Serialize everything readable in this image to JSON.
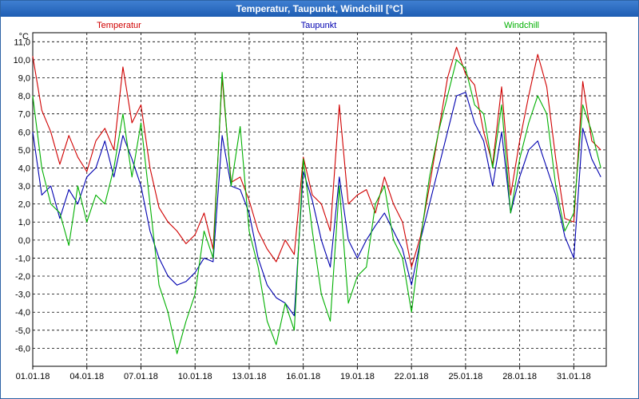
{
  "window": {
    "title": "Temperatur, Taupunkt, Windchill [°C]"
  },
  "colors": {
    "temperatur": "#d00000",
    "taupunkt": "#0000b0",
    "windchill": "#00b000",
    "grid": "#000000",
    "titlebar": "#2a6cc4"
  },
  "chart_data": {
    "type": "line",
    "title": "Temperatur, Taupunkt, Windchill [°C]",
    "unit": "°C",
    "ylim": [
      -7,
      11.5
    ],
    "xlim": [
      0,
      31.8
    ],
    "yticks": [
      11,
      10,
      9,
      8,
      7,
      6,
      5,
      4,
      3,
      2,
      1,
      0,
      -1,
      -2,
      -3,
      -4,
      -5,
      -6
    ],
    "ytick_labels": [
      "11,0",
      "10,0",
      "9,0",
      "8,0",
      "7,0",
      "6,0",
      "5,0",
      "4,0",
      "3,0",
      "2,0",
      "1,0",
      "0,0",
      "-1,0",
      "-2,0",
      "-3,0",
      "-4,0",
      "-5,0",
      "-6,0"
    ],
    "xticks": [
      0,
      3,
      6,
      9,
      12,
      15,
      18,
      21,
      24,
      27,
      30
    ],
    "xtick_labels": [
      "01.01.18",
      "04.01.18",
      "07.01.18",
      "10.01.18",
      "13.01.18",
      "16.01.18",
      "19.01.18",
      "22.01.18",
      "25.01.18",
      "28.01.18",
      "31.01.18"
    ],
    "grid": true,
    "legend_placement": "top",
    "series": [
      {
        "name": "Temperatur",
        "color": "#d00000",
        "x": [
          0,
          0.5,
          1,
          1.5,
          2,
          2.5,
          3,
          3.5,
          4,
          4.5,
          5,
          5.5,
          6,
          6.5,
          7,
          7.5,
          8,
          8.5,
          9,
          9.5,
          10,
          10.5,
          11,
          11.5,
          12,
          12.5,
          13,
          13.5,
          14,
          14.5,
          15,
          15.5,
          16,
          16.5,
          17,
          17.5,
          18,
          18.5,
          19,
          19.5,
          20,
          20.5,
          21,
          21.5,
          22,
          22.5,
          23,
          23.5,
          24,
          24.5,
          25,
          25.5,
          26,
          26.5,
          27,
          27.5,
          28,
          28.5,
          29,
          29.5,
          30,
          30.5,
          31,
          31.5
        ],
        "y": [
          10.2,
          7.2,
          6.0,
          4.2,
          5.8,
          4.6,
          3.8,
          5.5,
          6.2,
          5.0,
          9.6,
          6.5,
          7.5,
          4.0,
          1.8,
          1.0,
          0.5,
          -0.2,
          0.3,
          1.5,
          -0.5,
          9.0,
          3.2,
          3.5,
          2.2,
          0.5,
          -0.5,
          -1.2,
          0.0,
          -0.8,
          4.6,
          2.5,
          2.0,
          0.5,
          7.5,
          2.0,
          2.5,
          2.8,
          1.5,
          3.5,
          2.0,
          1.0,
          -1.5,
          0.2,
          3.0,
          6.0,
          9.0,
          10.7,
          9.2,
          8.6,
          6.0,
          4.2,
          8.5,
          2.5,
          5.5,
          8.0,
          10.3,
          8.5,
          4.5,
          1.2,
          1.0,
          8.8,
          5.5,
          5.0
        ]
      },
      {
        "name": "Taupunkt",
        "color": "#0000b0",
        "x": [
          0,
          0.5,
          1,
          1.5,
          2,
          2.5,
          3,
          3.5,
          4,
          4.5,
          5,
          5.5,
          6,
          6.5,
          7,
          7.5,
          8,
          8.5,
          9,
          9.5,
          10,
          10.5,
          11,
          11.5,
          12,
          12.5,
          13,
          13.5,
          14,
          14.5,
          15,
          15.5,
          16,
          16.5,
          17,
          17.5,
          18,
          18.5,
          19,
          19.5,
          20,
          20.5,
          21,
          21.5,
          22,
          22.5,
          23,
          23.5,
          24,
          24.5,
          25,
          25.5,
          26,
          26.5,
          27,
          27.5,
          28,
          28.5,
          29,
          29.5,
          30,
          30.5,
          31,
          31.5
        ],
        "y": [
          6.0,
          2.5,
          3.0,
          1.2,
          2.8,
          2.0,
          3.5,
          4.0,
          5.5,
          3.5,
          5.8,
          4.5,
          3.0,
          0.5,
          -1.0,
          -2.0,
          -2.5,
          -2.3,
          -1.8,
          -1.0,
          -1.2,
          5.8,
          3.0,
          2.8,
          1.5,
          -1.0,
          -2.5,
          -3.2,
          -3.5,
          -4.2,
          3.8,
          2.2,
          0.0,
          -1.5,
          3.5,
          0.0,
          -1.0,
          0.0,
          0.8,
          1.5,
          0.5,
          -0.5,
          -2.5,
          0.0,
          2.0,
          4.0,
          6.0,
          8.0,
          8.2,
          6.5,
          5.5,
          3.0,
          6.0,
          1.5,
          3.5,
          5.0,
          5.5,
          4.0,
          2.5,
          0.2,
          -1.0,
          6.2,
          4.5,
          3.5
        ]
      },
      {
        "name": "Windchill",
        "color": "#00b000",
        "x": [
          0,
          0.5,
          1,
          1.5,
          2,
          2.5,
          3,
          3.5,
          4,
          4.5,
          5,
          5.5,
          6,
          6.5,
          7,
          7.5,
          8,
          8.5,
          9,
          9.5,
          10,
          10.5,
          11,
          11.5,
          12,
          12.5,
          13,
          13.5,
          14,
          14.5,
          15,
          15.5,
          16,
          16.5,
          17,
          17.5,
          18,
          18.5,
          19,
          19.5,
          20,
          20.5,
          21,
          21.5,
          22,
          22.5,
          23,
          23.5,
          24,
          24.5,
          25,
          25.5,
          26,
          26.5,
          27,
          27.5,
          28,
          28.5,
          29,
          29.5,
          30,
          30.5,
          31,
          31.5
        ],
        "y": [
          8.0,
          4.0,
          2.0,
          1.5,
          -0.3,
          3.0,
          1.0,
          2.5,
          2.0,
          4.0,
          7.0,
          3.5,
          6.5,
          2.0,
          -2.5,
          -4.0,
          -6.3,
          -4.5,
          -3.0,
          0.5,
          -1.0,
          9.3,
          3.0,
          6.3,
          0.5,
          -1.5,
          -4.5,
          -5.8,
          -3.5,
          -5.0,
          4.5,
          0.5,
          -3.0,
          -4.5,
          3.0,
          -3.5,
          -2.0,
          -1.5,
          2.0,
          3.0,
          0.0,
          -1.0,
          -4.0,
          0.0,
          3.5,
          6.0,
          8.0,
          10.0,
          9.5,
          7.5,
          7.0,
          4.0,
          7.5,
          1.5,
          4.5,
          6.5,
          8.0,
          7.0,
          3.0,
          0.5,
          1.5,
          7.5,
          6.0,
          4.0
        ]
      }
    ]
  }
}
